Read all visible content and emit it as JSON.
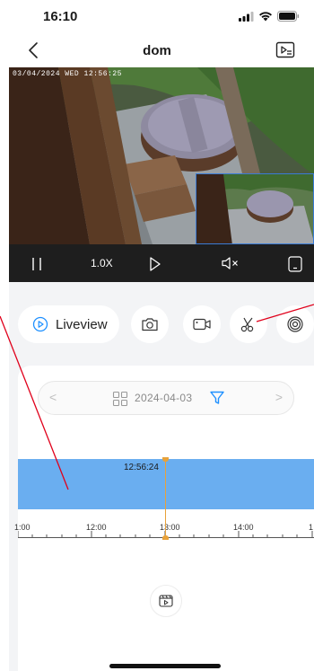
{
  "status_bar": {
    "time": "16:10"
  },
  "nav": {
    "title": "dom"
  },
  "video": {
    "timestamp": "03/04/2024 WED 12:56:25"
  },
  "controls": {
    "speed": "1.0X"
  },
  "actions": {
    "liveview_label": "Liveview"
  },
  "date_picker": {
    "date": "2024-04-03"
  },
  "timeline": {
    "current_time": "12:56:24",
    "ticks": [
      "1:00",
      "12:00",
      "13:00",
      "14:00",
      "1"
    ]
  },
  "colors": {
    "accent": "#1e90ff",
    "timeline_fill": "#6aaef0",
    "cursor": "#e8a23a",
    "annotation": "#e0001b"
  }
}
